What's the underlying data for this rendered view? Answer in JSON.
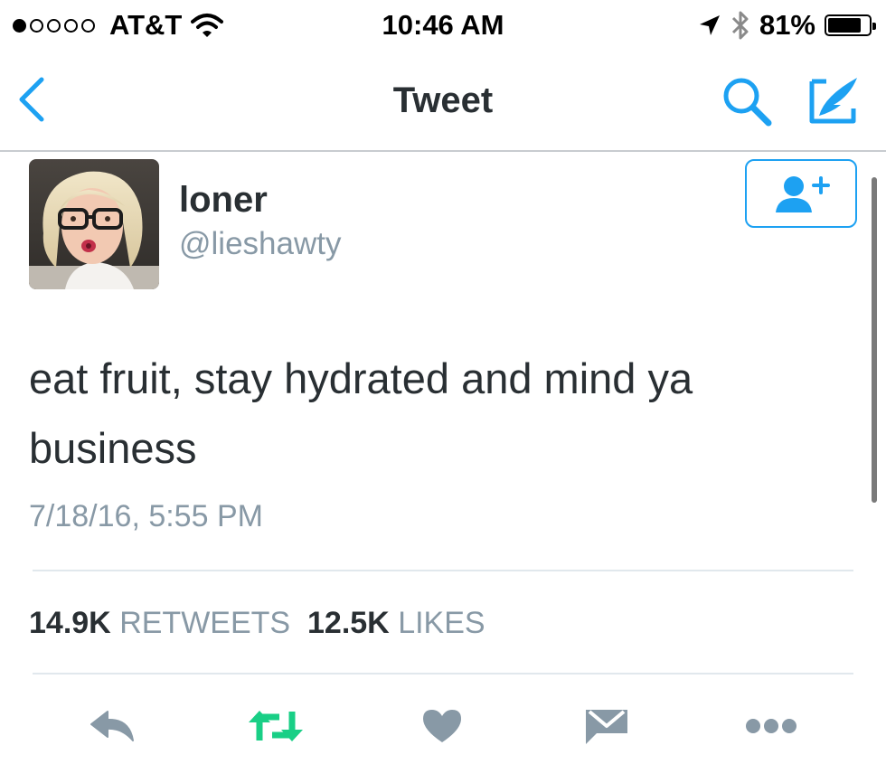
{
  "status_bar": {
    "signal_dots_filled": 1,
    "signal_dots_total": 5,
    "carrier": "AT&T",
    "wifi_icon": "wifi-icon",
    "time": "10:46 AM",
    "location_icon": "location-arrow-icon",
    "bluetooth_icon": "bluetooth-icon",
    "battery_percent": "81%",
    "battery_level": 0.81
  },
  "nav": {
    "title": "Tweet",
    "back_icon": "chevron-left-icon",
    "search_icon": "search-icon",
    "compose_icon": "compose-icon",
    "accent_color": "#1da1f2"
  },
  "tweet": {
    "display_name": "loner",
    "handle": "@lieshawty",
    "text": "eat fruit, stay hydrated and mind ya business",
    "timestamp": "7/18/16, 5:55 PM",
    "follow_icon": "add-user-icon",
    "stats": {
      "retweets_count": "14.9K",
      "retweets_label": "RETWEETS",
      "likes_count": "12.5K",
      "likes_label": "LIKES"
    },
    "actions": [
      {
        "name": "reply",
        "icon": "reply-icon"
      },
      {
        "name": "retweet",
        "icon": "retweet-icon",
        "color": "#19cf86"
      },
      {
        "name": "like",
        "icon": "heart-icon"
      },
      {
        "name": "message",
        "icon": "envelope-icon"
      },
      {
        "name": "more",
        "icon": "more-icon"
      }
    ]
  },
  "colors": {
    "text_primary": "#292f33",
    "text_secondary": "#8899a6",
    "divider": "#e1e8ed",
    "action_gray": "#8899a6",
    "retweet_green": "#19cf86"
  }
}
